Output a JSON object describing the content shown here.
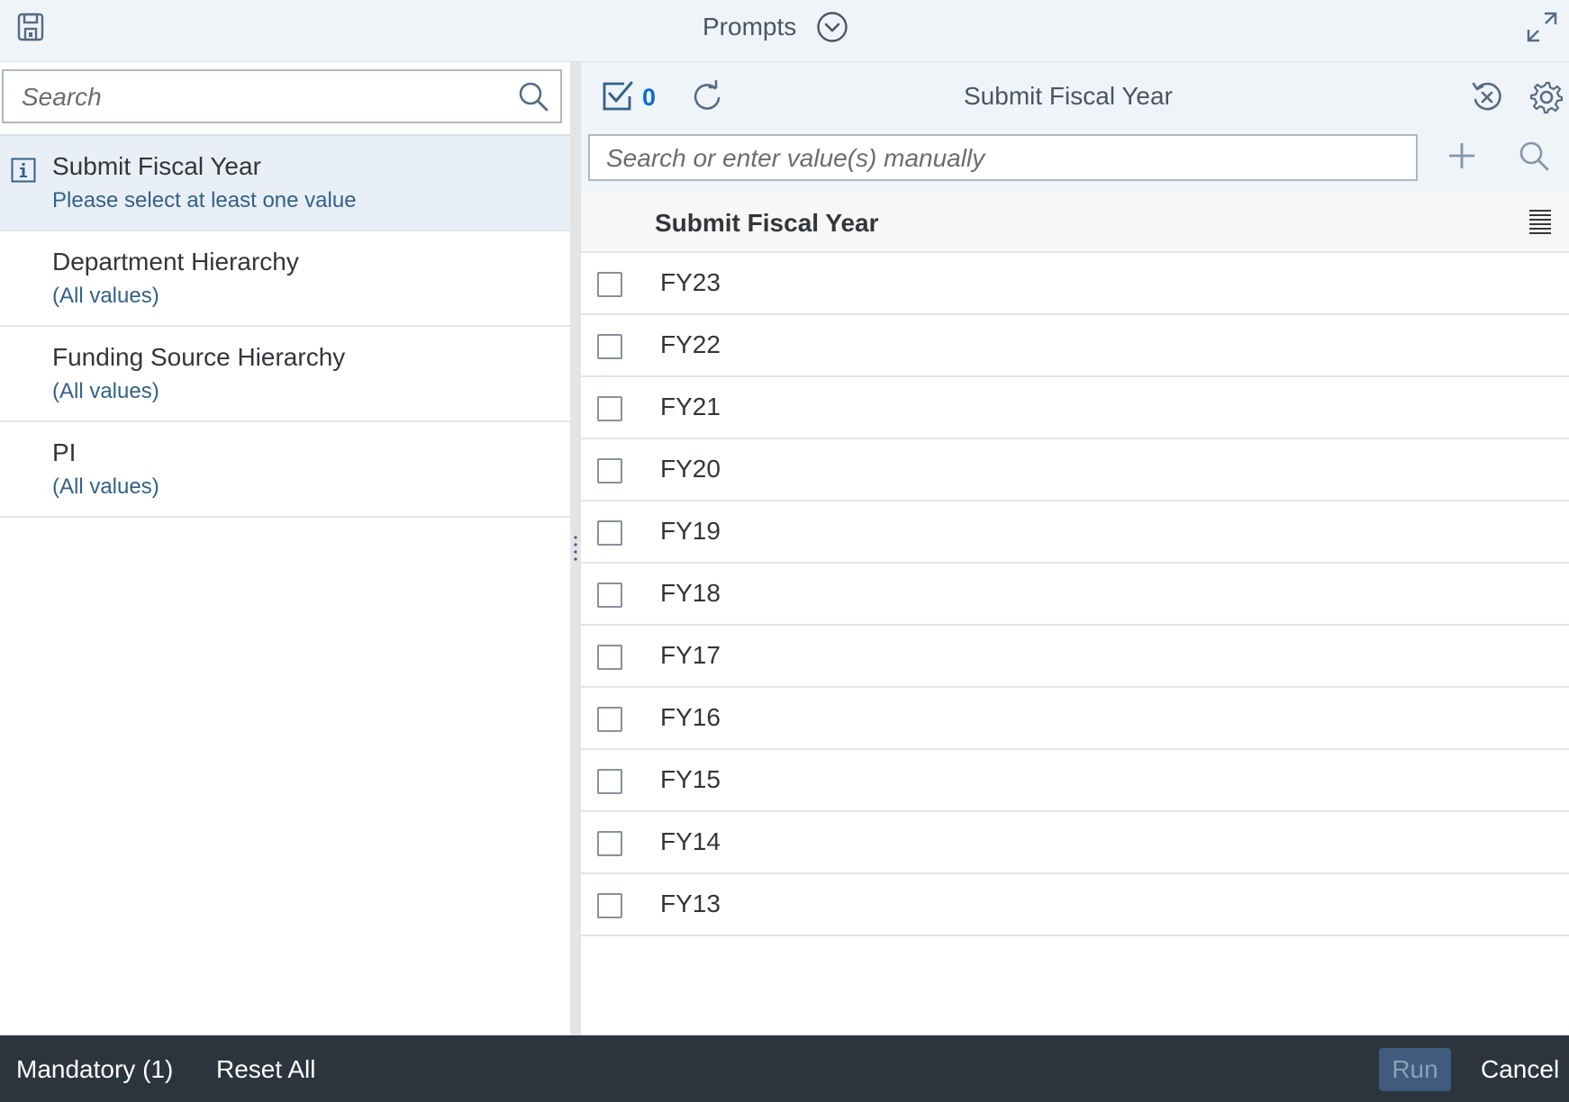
{
  "header": {
    "title": "Prompts",
    "icons": {
      "save": "save-icon",
      "dropdown": "chevron-down-circle-icon",
      "expand": "expand-icon"
    }
  },
  "left_panel": {
    "search_placeholder": "Search",
    "items": [
      {
        "title": "Submit Fiscal Year",
        "subtitle": "Please select at least one value",
        "selected": true,
        "icon": "info-icon"
      },
      {
        "title": "Department Hierarchy",
        "subtitle": "(All values)",
        "selected": false
      },
      {
        "title": "Funding Source Hierarchy",
        "subtitle": "(All values)",
        "selected": false
      },
      {
        "title": "PI",
        "subtitle": "(All values)",
        "selected": false
      }
    ]
  },
  "right_panel": {
    "selected_count": "0",
    "title": "Submit Fiscal Year",
    "value_search_placeholder": "Search or enter value(s) manually",
    "column_header": "Submit Fiscal Year",
    "values": [
      {
        "label": "FY23",
        "checked": false
      },
      {
        "label": "FY22",
        "checked": false
      },
      {
        "label": "FY21",
        "checked": false
      },
      {
        "label": "FY20",
        "checked": false
      },
      {
        "label": "FY19",
        "checked": false
      },
      {
        "label": "FY18",
        "checked": false
      },
      {
        "label": "FY17",
        "checked": false
      },
      {
        "label": "FY16",
        "checked": false
      },
      {
        "label": "FY15",
        "checked": false
      },
      {
        "label": "FY14",
        "checked": false
      },
      {
        "label": "FY13",
        "checked": false
      }
    ]
  },
  "footer": {
    "mandatory_label": "Mandatory (1)",
    "reset_label": "Reset All",
    "run_label": "Run",
    "cancel_label": "Cancel"
  },
  "colors": {
    "accent": "#0a6ed1",
    "link": "#346187",
    "header_bg": "#eff4f9",
    "footer_bg": "#2c353e",
    "selected_row_bg": "#e8eff6",
    "run_button_bg": "#3f5b7d"
  }
}
